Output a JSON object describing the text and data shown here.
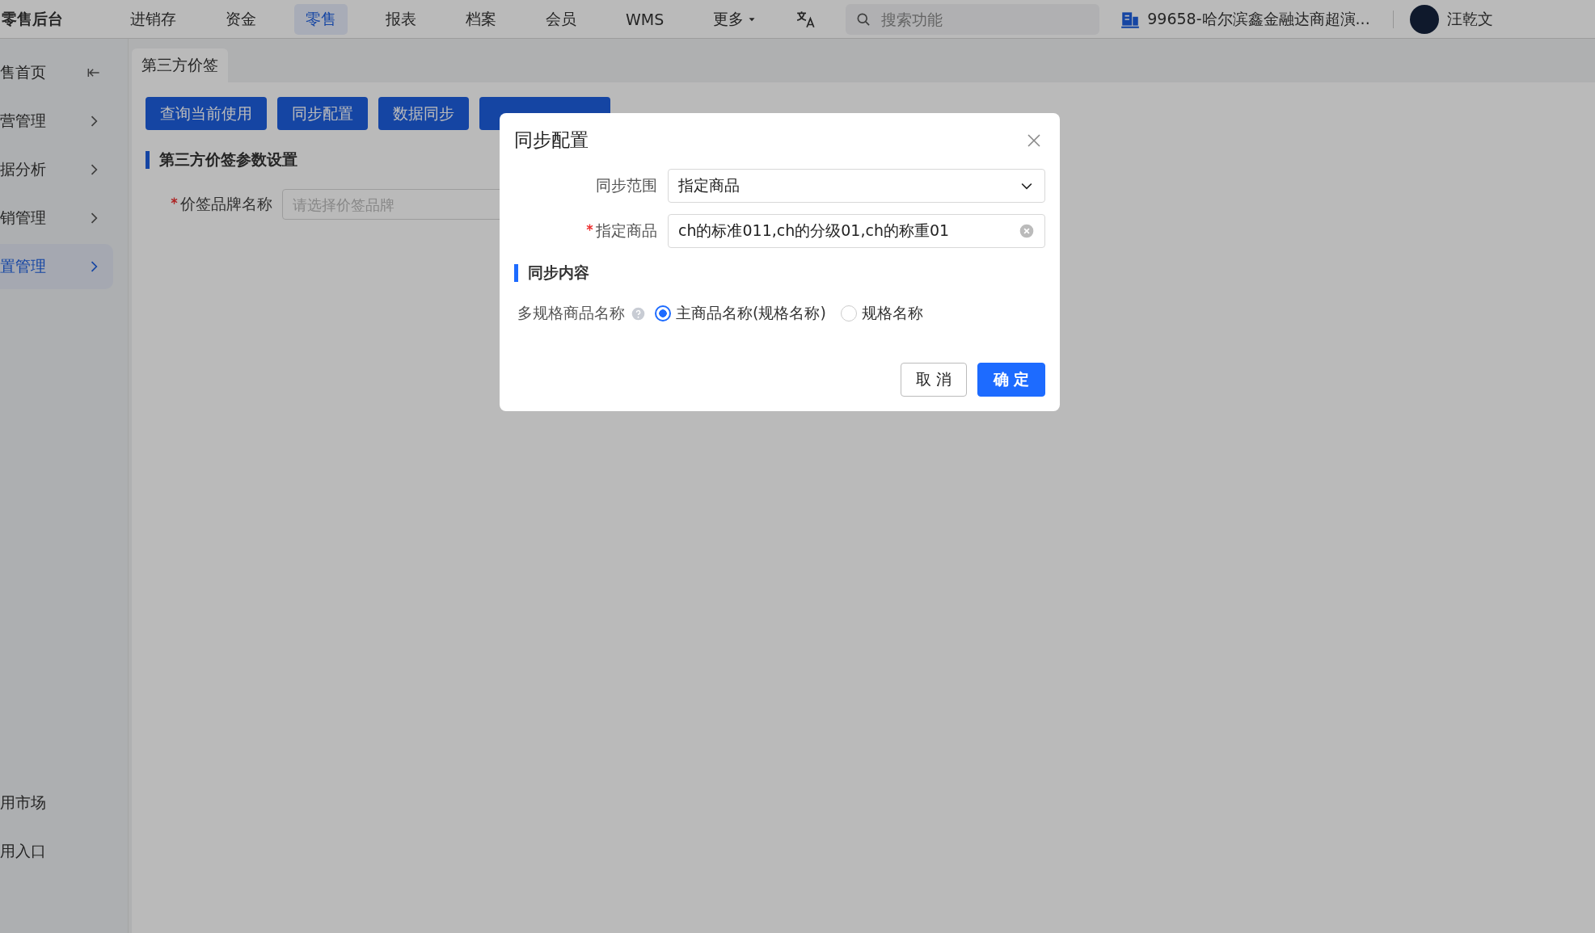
{
  "top_bar": {
    "logo": "零售后台",
    "nav": [
      {
        "label": "进销存",
        "selected": false,
        "kind": "link"
      },
      {
        "label": "资金",
        "selected": false,
        "kind": "link"
      },
      {
        "label": "零售",
        "selected": true,
        "kind": "link"
      },
      {
        "label": "报表",
        "selected": false,
        "kind": "link"
      },
      {
        "label": "档案",
        "selected": false,
        "kind": "link"
      },
      {
        "label": "会员",
        "selected": false,
        "kind": "link"
      },
      {
        "label": "WMS",
        "selected": false,
        "kind": "link"
      },
      {
        "label": "更多",
        "selected": false,
        "kind": "dropdown"
      }
    ],
    "search": {
      "placeholder": "搜索功能"
    },
    "org": "99658-哈尔滨鑫金融达商超演...",
    "user": "汪乾文"
  },
  "sidebar": {
    "items": [
      {
        "label": "售首页",
        "selected": false,
        "kind": "home"
      },
      {
        "label": "营管理",
        "selected": false,
        "kind": "menu"
      },
      {
        "label": "据分析",
        "selected": false,
        "kind": "menu"
      },
      {
        "label": "销管理",
        "selected": false,
        "kind": "menu"
      },
      {
        "label": "置管理",
        "selected": true,
        "kind": "menu"
      }
    ],
    "bottom_items": [
      "用市场",
      "用入口"
    ]
  },
  "tabs": [
    {
      "label": "第三方价签",
      "selected": true
    }
  ],
  "toolbar_buttons": [
    {
      "kind": "labeled",
      "label": "查询当前使用"
    },
    {
      "kind": "labeled",
      "label": "同步配置"
    },
    {
      "kind": "labeled",
      "label": "数据同步"
    },
    {
      "kind": "covered"
    }
  ],
  "section_title": "第三方价签参数设置",
  "form": {
    "fields": [
      {
        "label": "价签品牌名称",
        "required": true,
        "placeholder": "请选择价签品牌"
      }
    ]
  },
  "dialog": {
    "title": "同步配置",
    "fields": [
      {
        "label": "同步范围",
        "required": false,
        "kind": "select",
        "value": "指定商品"
      },
      {
        "label": "指定商品",
        "required": true,
        "kind": "clearable",
        "value": "ch的标准011,ch的分级01,ch的称重01"
      }
    ],
    "section_title": "同步内容",
    "radio_group": {
      "label": "多规格商品名称",
      "options": [
        {
          "label": "主商品名称(规格名称)",
          "selected": true
        },
        {
          "label": "规格名称",
          "selected": false
        }
      ]
    },
    "buttons": [
      {
        "label": "取 消",
        "kind": "secondary"
      },
      {
        "label": "确 定",
        "kind": "primary"
      }
    ]
  }
}
